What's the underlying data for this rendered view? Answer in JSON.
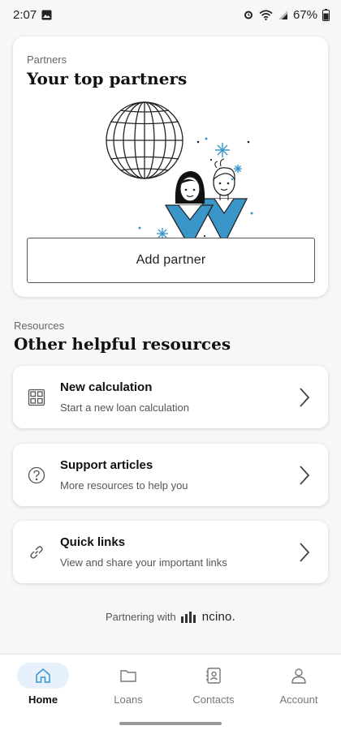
{
  "status_bar": {
    "time": "2:07",
    "battery": "67%",
    "icons": [
      "image-notification-icon",
      "alarm-icon",
      "wifi-icon",
      "signal-icon",
      "battery-icon"
    ]
  },
  "partners": {
    "eyebrow": "Partners",
    "title": "Your top partners",
    "illustration": "globe-with-two-people-illustration",
    "add_button": "Add partner"
  },
  "resources": {
    "eyebrow": "Resources",
    "title": "Other helpful resources",
    "items": [
      {
        "title": "New calculation",
        "subtitle": "Start a new loan calculation",
        "icon": "calculator-icon"
      },
      {
        "title": "Support articles",
        "subtitle": "More resources to help you",
        "icon": "help-circle-icon"
      },
      {
        "title": "Quick links",
        "subtitle": "View and share your important links",
        "icon": "link-icon"
      }
    ]
  },
  "footer": {
    "prefix": "Partnering with",
    "brand": "ncino."
  },
  "nav": {
    "items": [
      {
        "label": "Home",
        "icon": "home-icon",
        "active": true
      },
      {
        "label": "Loans",
        "icon": "folder-icon",
        "active": false
      },
      {
        "label": "Contacts",
        "icon": "contact-card-icon",
        "active": false
      },
      {
        "label": "Account",
        "icon": "person-icon",
        "active": false
      }
    ]
  },
  "colors": {
    "accent": "#3a96c8",
    "active_nav_bg": "#e6f1fb"
  }
}
